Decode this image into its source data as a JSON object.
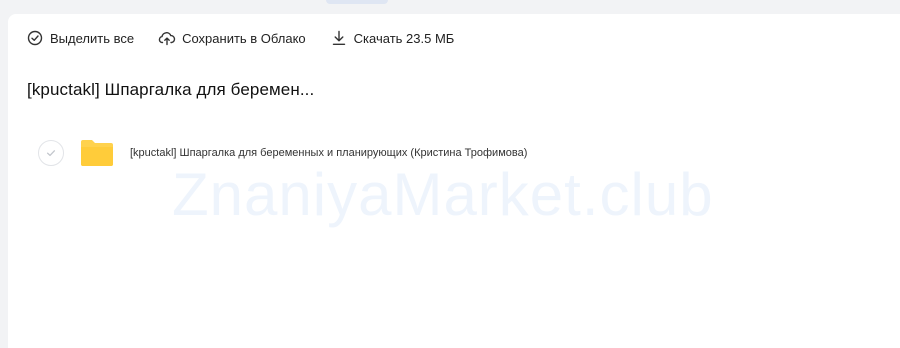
{
  "toolbar": {
    "select_all": "Выделить все",
    "save_to_cloud": "Сохранить в Облако",
    "download": "Скачать 23.5 МБ"
  },
  "folder": {
    "title": "[kpuctakl] Шпаргалка для беремен...",
    "items": [
      {
        "name": "[kpuctakl] Шпаргалка для беременных и планирующих (Кристина Трофимова)",
        "icon": "folder-icon",
        "color": "#ffd24d"
      }
    ]
  },
  "watermark": "ZnaniyaMarket.club",
  "colors": {
    "background": "#f2f3f5",
    "panel": "#ffffff",
    "folder": "#ffd24d",
    "accent_pill": "#dfe6f3"
  }
}
